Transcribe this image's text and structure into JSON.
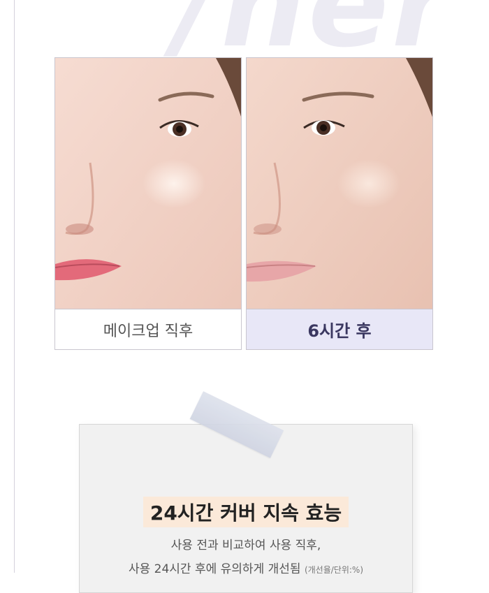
{
  "background_word": "/her",
  "comparison": {
    "before_label": "메이크업 직후",
    "after_label": "6시간 후"
  },
  "claim": {
    "title": "24시간 커버 지속 효능",
    "line1": "사용 전과 비교하여 사용 직후,",
    "line2_main": "사용 24시간 후에 유의하게 개선됨",
    "line2_note": "(개선율/단위:%)"
  },
  "colors": {
    "after_caption_bg": "#e8e7f7",
    "title_highlight": "#fbe9d9",
    "note_bg": "#f1f1f1"
  }
}
